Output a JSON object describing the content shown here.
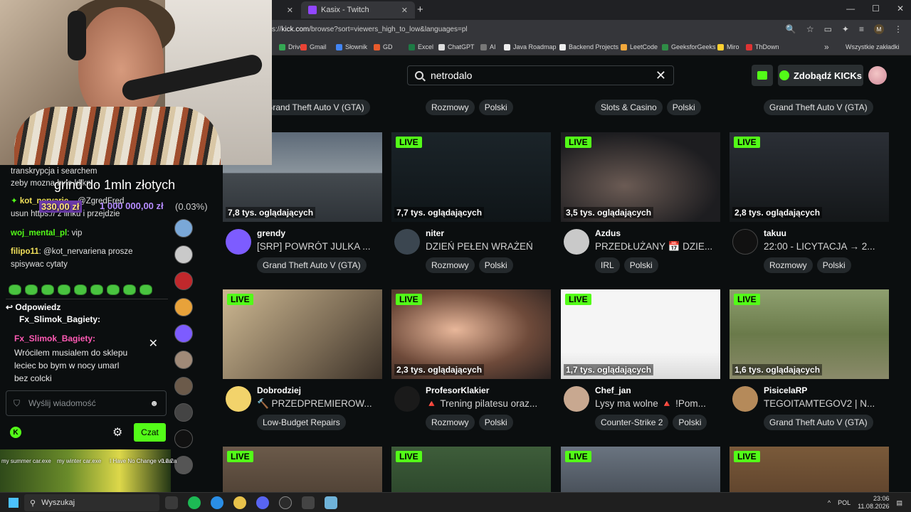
{
  "browser": {
    "tab1": {
      "close": "✕"
    },
    "tab2": {
      "title": "Kasix - Twitch",
      "close": "✕"
    },
    "new_tab": "+",
    "url_prefix": "s://",
    "url_host": "kick.com",
    "url_path": "/browse?sort=viewers_high_to_low&languages=pl",
    "profile_initial": "M",
    "bookmarks": [
      "Drive",
      "Gmail",
      "Słownik",
      "GD",
      "Excel",
      "ChatGPT",
      "AI",
      "Java Roadmap",
      "Backend Projects",
      "LeetCode",
      "GeeksforGeeks",
      "Miro",
      "ThDown"
    ],
    "bookmark_more": "»",
    "all_bookmarks": "Wszystkie zakładki"
  },
  "kick": {
    "search_value": "netrodalo",
    "kicks_button": "Zdobądź KICKs",
    "top_row_tags": [
      [
        "Grand Theft Auto V (GTA)"
      ],
      [
        "Rozmowy",
        "Polski"
      ],
      [
        "Slots & Casino",
        "Polski"
      ],
      [
        "Grand Theft Auto V (GTA)"
      ]
    ],
    "live_label": "LIVE",
    "cards": [
      {
        "viewers": "7,8 tys. oglądających",
        "name": "grendy",
        "title": "[SRP] POWRÓT JULKA ...",
        "tags": [
          "Grand Theft Auto V (GTA)"
        ],
        "accent": "#7d5cff"
      },
      {
        "viewers": "7,7 tys. oglądających",
        "name": "niter",
        "title": "DZIEŃ PEŁEN WRAŻEŃ",
        "tags": [
          "Rozmowy",
          "Polski"
        ],
        "accent": "#3b4650"
      },
      {
        "viewers": "3,5 tys. oglądających",
        "name": "Azdus",
        "title": "PRZEDŁUŻANY 📅 DZIE...",
        "tags": [
          "IRL",
          "Polski"
        ],
        "accent": "#c9c9c9"
      },
      {
        "viewers": "2,8 tys. oglądających",
        "name": "takuu",
        "title": "22:00 - LICYTACJA → 2...",
        "tags": [
          "Rozmowy",
          "Polski"
        ],
        "accent": "#111111"
      },
      {
        "viewers": "",
        "name": "Dobrodziej",
        "title": "🔨 PRZEDPREMIEROW...",
        "tags": [
          "Low-Budget Repairs"
        ],
        "accent": "#f2d36b"
      },
      {
        "viewers": "2,3 tys. oglądających",
        "name": "ProfesorKlakier",
        "title": "🔺 Trening pilatesu oraz...",
        "tags": [
          "Rozmowy",
          "Polski"
        ],
        "accent": "#1a1a1a"
      },
      {
        "viewers": "1,7 tys. oglądających",
        "name": "Chef_jan",
        "title": "Lysy ma wolne 🔺 !Pom...",
        "tags": [
          "Counter-Strike 2",
          "Polski"
        ],
        "accent": "#c8a890"
      },
      {
        "viewers": "1,6 tys. oglądających",
        "name": "PisicelaRP",
        "title": "TEGOITAMTEGOV2 | N...",
        "tags": [
          "Grand Theft Auto V (GTA)"
        ],
        "accent": "#b58a5a"
      }
    ]
  },
  "overlay": {
    "goal_text": "grind do 1mln złotych",
    "goal_amount": "330,00 zł",
    "goal_target": "1 000 000,00 zł",
    "goal_percent": "(0.03%)"
  },
  "chat": {
    "lines": [
      {
        "text": "transkrypcja i searchem"
      },
      {
        "text": "zeby mozna bylo klikn..."
      },
      {
        "user": "kot_nervarie...",
        "text": " @ZgredFred"
      },
      {
        "text": "usun https:// z linku i przejdzie"
      },
      {
        "user": "woj_mental_pl",
        "text": ": vip"
      },
      {
        "user": "filipo11",
        "text": ": @kot_nervariena prosze spisywac cytaty"
      }
    ],
    "reply_header": "Odpowiedz",
    "reply_to": "Fx_Slimok_Bagiety:",
    "reply_name": "Fx_Slimok_Bagiety",
    "reply_message": "Wrócilem musialem do sklepu leciec bo bym w nocy umarl bez colcki",
    "input_placeholder": "Wyślij wiadomość",
    "send_button": "Czat",
    "kick_badge": "K"
  },
  "desktop": {
    "icons": [
      "my summer car.exe",
      "my winter car.exe",
      "I Have No Change v0.2.2a",
      "Lea"
    ]
  },
  "taskbar": {
    "search_placeholder": "Wyszukaj",
    "language": "POL",
    "time": "23:06",
    "date": "11.08.2026"
  }
}
